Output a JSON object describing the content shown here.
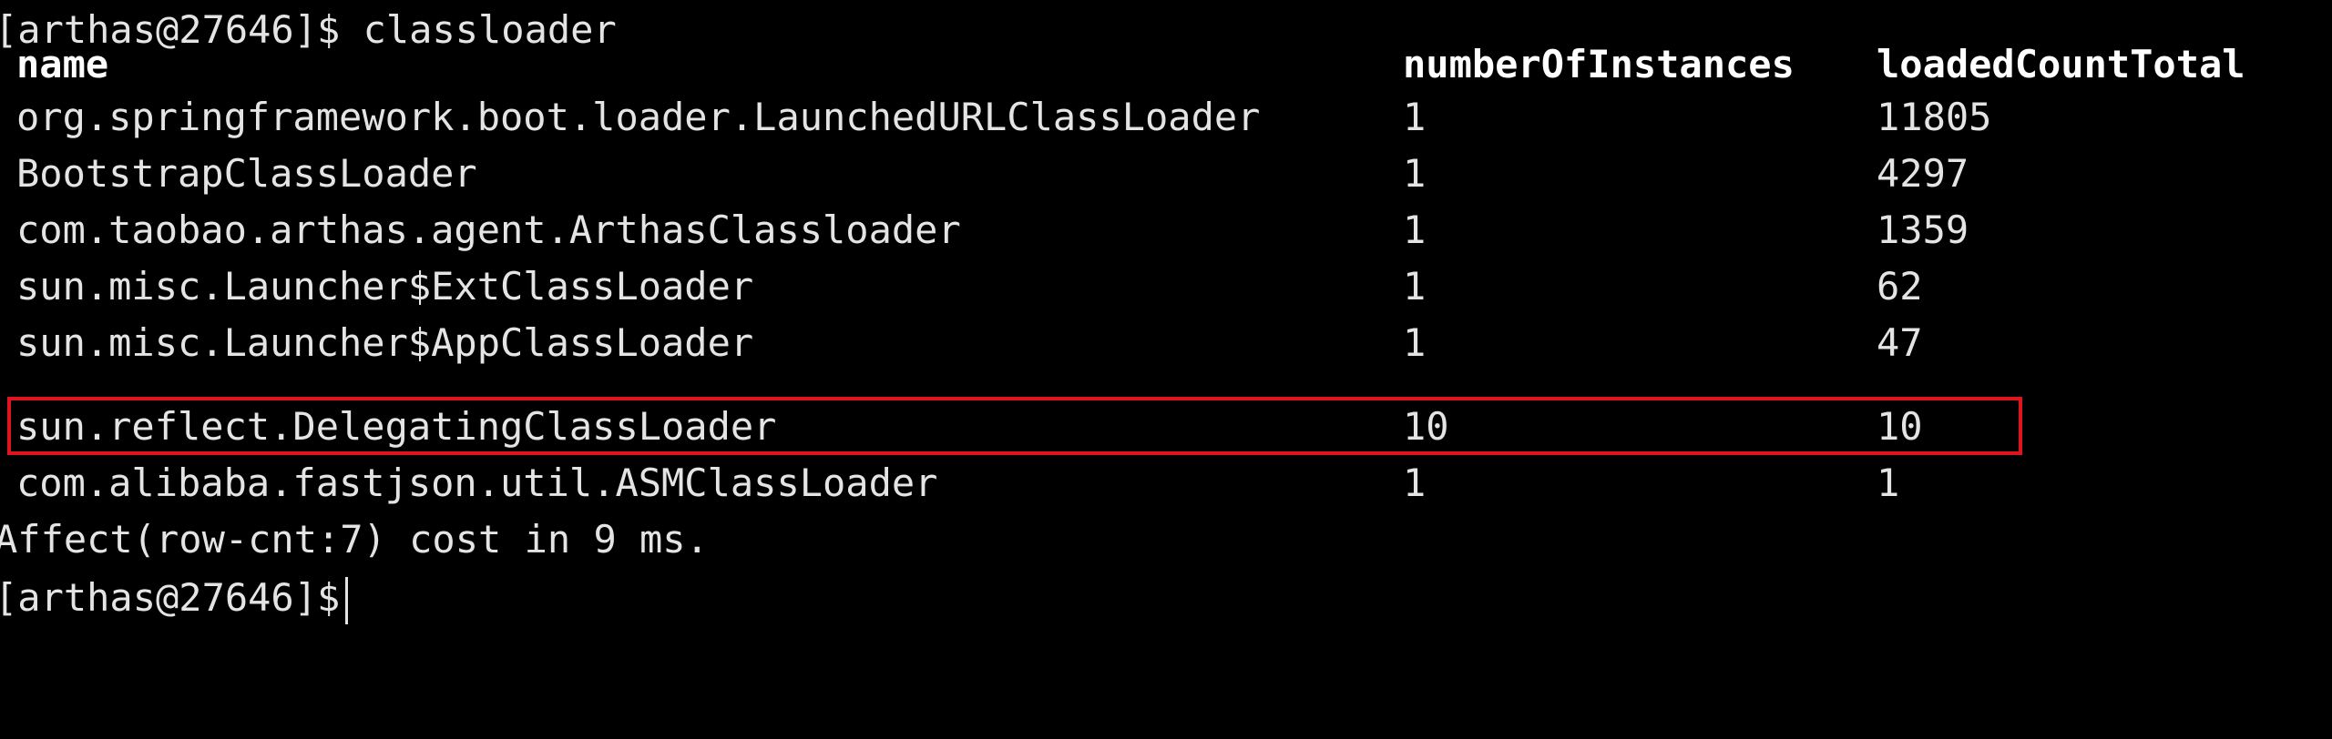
{
  "prompt": {
    "user_host": "[arthas@27646]$",
    "command": "classloader"
  },
  "table": {
    "columns": [
      "name",
      "numberOfInstances",
      "loadedCountTotal"
    ],
    "rows": [
      {
        "name": "org.springframework.boot.loader.LaunchedURLClassLoader",
        "instances": "1",
        "loaded": "11805"
      },
      {
        "name": "BootstrapClassLoader",
        "instances": "1",
        "loaded": "4297"
      },
      {
        "name": "com.taobao.arthas.agent.ArthasClassloader",
        "instances": "1",
        "loaded": "1359"
      },
      {
        "name": "sun.misc.Launcher$ExtClassLoader",
        "instances": "1",
        "loaded": "62"
      },
      {
        "name": "sun.misc.Launcher$AppClassLoader",
        "instances": "1",
        "loaded": "47"
      },
      {
        "name": "sun.reflect.DelegatingClassLoader",
        "instances": "10",
        "loaded": "10",
        "highlighted": true
      },
      {
        "name": "com.alibaba.fastjson.util.ASMClassLoader",
        "instances": "1",
        "loaded": "1"
      }
    ]
  },
  "summary": "Affect(row-cnt:7) cost in 9 ms.",
  "next_prompt": "[arthas@27646]$",
  "colors": {
    "background": "#000000",
    "text": "#e4e4e4",
    "highlight": "#e0141e"
  }
}
